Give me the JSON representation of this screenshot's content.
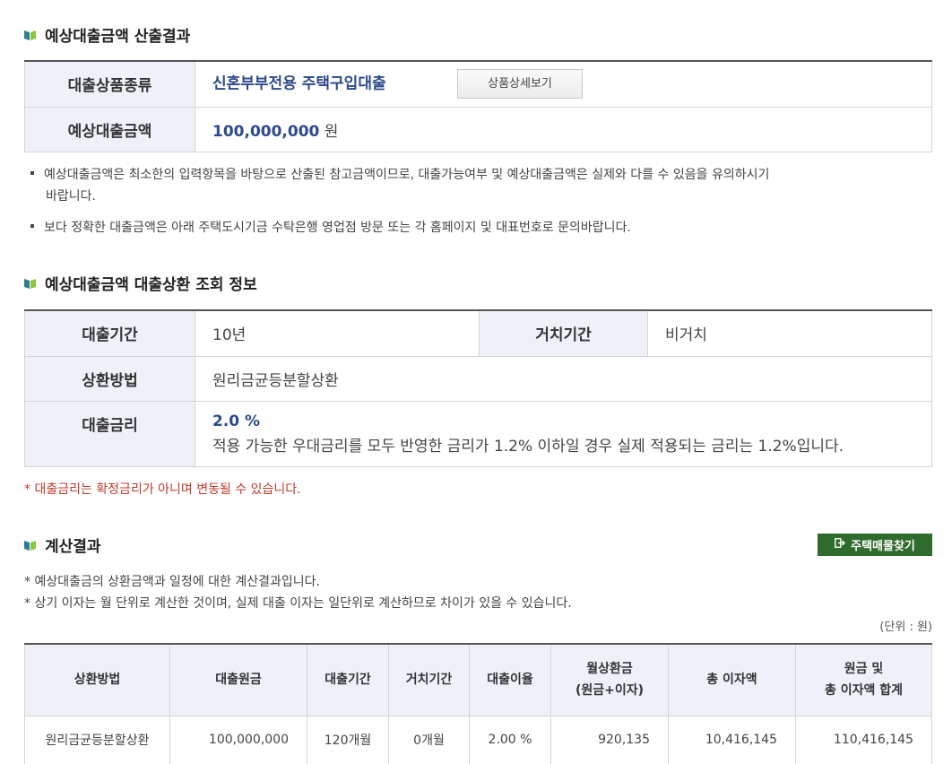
{
  "section1": {
    "title": "예상대출금액 산출결과",
    "product_label": "대출상품종류",
    "product_value": "신혼부부전용 주택구입대출",
    "detail_button": "상품상세보기",
    "amount_label": "예상대출금액",
    "amount_value": "100,000,000",
    "amount_unit": "원",
    "notes": [
      "예상대출금액은 최소한의 입력항목을 바탕으로 산출된 참고금액이므로, 대출가능여부 및 예상대출금액은 실제와 다를 수 있음을 유의하시기",
      "바랍니다.",
      "보다 정확한 대출금액은 아래 주택도시기금 수탁은행 영업점 방문 또는 각 홈페이지 및 대표번호로 문의바랍니다."
    ]
  },
  "section2": {
    "title": "예상대출금액 대출상환 조회 정보",
    "period_label": "대출기간",
    "period_value": "10년",
    "grace_label": "거치기간",
    "grace_value": "비거치",
    "method_label": "상환방법",
    "method_value": "원리금균등분할상환",
    "rate_label": "대출금리",
    "rate_value": "2.0 %",
    "rate_note": "적용 가능한 우대금리를 모두 반영한 금리가 1.2% 이하일 경우 실제 적용되는 금리는 1.2%입니다.",
    "red_note": "* 대출금리는 확정금리가 아니며 변동될 수 있습니다."
  },
  "section3": {
    "title": "계산결과",
    "find_button": "주택매물찾기",
    "notes": [
      "* 예상대출금의 상환금액과 일정에 대한 계산결과입니다.",
      "* 상기 이자는 월 단위로 계산한 것이며, 실제 대출 이자는 일단위로 계산하므로 차이가 있을 수 있습니다."
    ],
    "unit": "(단위 : 원)",
    "headers": {
      "method": "상환방법",
      "principal": "대출원금",
      "period": "대출기간",
      "grace": "거치기간",
      "rate": "대출이율",
      "monthly_1": "월상환금",
      "monthly_2": "(원금+이자)",
      "interest": "총 이자액",
      "total_1": "원금 및",
      "total_2": "총 이자액 합계"
    },
    "row": {
      "method": "원리금균등분할상환",
      "principal": "100,000,000",
      "period": "120개월",
      "grace": "0개월",
      "rate": "2.00 %",
      "monthly": "920,135",
      "interest": "10,416,145",
      "total": "110,416,145"
    }
  },
  "colors": {
    "accent_blue": "#2b4a8b",
    "header_bg": "#eef2f8",
    "button_green": "#2f6b2c",
    "warning_red": "#c0392b"
  }
}
